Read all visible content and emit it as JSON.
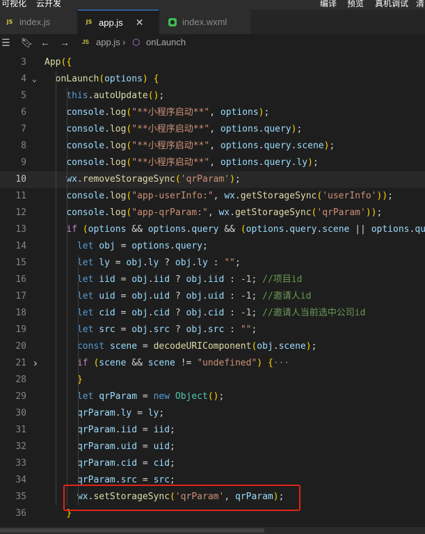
{
  "toolbar": {
    "left_items": [
      "可视化",
      "云开发"
    ],
    "right_items": [
      "编译",
      "预览",
      "真机调试",
      "清"
    ]
  },
  "tabs": [
    {
      "label": "index.js",
      "active": false
    },
    {
      "label": "app.js",
      "active": true
    },
    {
      "label": "index.wxml",
      "active": false
    }
  ],
  "breadcrumb": {
    "file": "app.js",
    "symbol": "onLaunch"
  },
  "colors": {
    "accent": "#3794ff",
    "highlight_box": "#e0251b"
  },
  "code_lines": [
    {
      "num": "3",
      "text": "App({"
    },
    {
      "num": "4",
      "text": "  onLaunch(options) {"
    },
    {
      "num": "5",
      "text": "    this.autoUpdate();"
    },
    {
      "num": "6",
      "text": "    console.log(\"**小程序启动**\", options);"
    },
    {
      "num": "7",
      "text": "    console.log(\"**小程序启动**\", options.query);"
    },
    {
      "num": "8",
      "text": "    console.log(\"**小程序启动**\", options.query.scene);"
    },
    {
      "num": "9",
      "text": "    console.log(\"**小程序启动**\", options.query.ly);"
    },
    {
      "num": "10",
      "text": "    wx.removeStorageSync('qrParam');",
      "current": true
    },
    {
      "num": "11",
      "text": "    console.log(\"app-userInfo:\", wx.getStorageSync('userInfo'));"
    },
    {
      "num": "12",
      "text": "    console.log(\"app-qrParam:\", wx.getStorageSync('qrParam'));"
    },
    {
      "num": "13",
      "text": "    if (options && options.query && (options.query.scene || options.que"
    },
    {
      "num": "14",
      "text": "      let obj = options.query;"
    },
    {
      "num": "15",
      "text": "      let ly = obj.ly ? obj.ly : \"\";"
    },
    {
      "num": "16",
      "text": "      let iid = obj.iid ? obj.iid : -1; //项目id"
    },
    {
      "num": "17",
      "text": "      let uid = obj.uid ? obj.uid : -1; //邀请人id"
    },
    {
      "num": "18",
      "text": "      let cid = obj.cid ? obj.cid : -1; //邀请人当前选中公司id"
    },
    {
      "num": "19",
      "text": "      let src = obj.src ? obj.src : \"\";"
    },
    {
      "num": "20",
      "text": "      const scene = decodeURIComponent(obj.scene);"
    },
    {
      "num": "21",
      "text": "      if (scene && scene != \"undefined\") {···",
      "folded": true
    },
    {
      "num": "28",
      "text": "      }"
    },
    {
      "num": "29",
      "text": "      let qrParam = new Object();"
    },
    {
      "num": "30",
      "text": "      qrParam.ly = ly;"
    },
    {
      "num": "31",
      "text": "      qrParam.iid = iid;"
    },
    {
      "num": "32",
      "text": "      qrParam.uid = uid;"
    },
    {
      "num": "33",
      "text": "      qrParam.cid = cid;"
    },
    {
      "num": "34",
      "text": "      qrParam.src = src;"
    },
    {
      "num": "35",
      "text": "      wx.setStorageSync('qrParam', qrParam);"
    },
    {
      "num": "36",
      "text": "    }"
    }
  ]
}
